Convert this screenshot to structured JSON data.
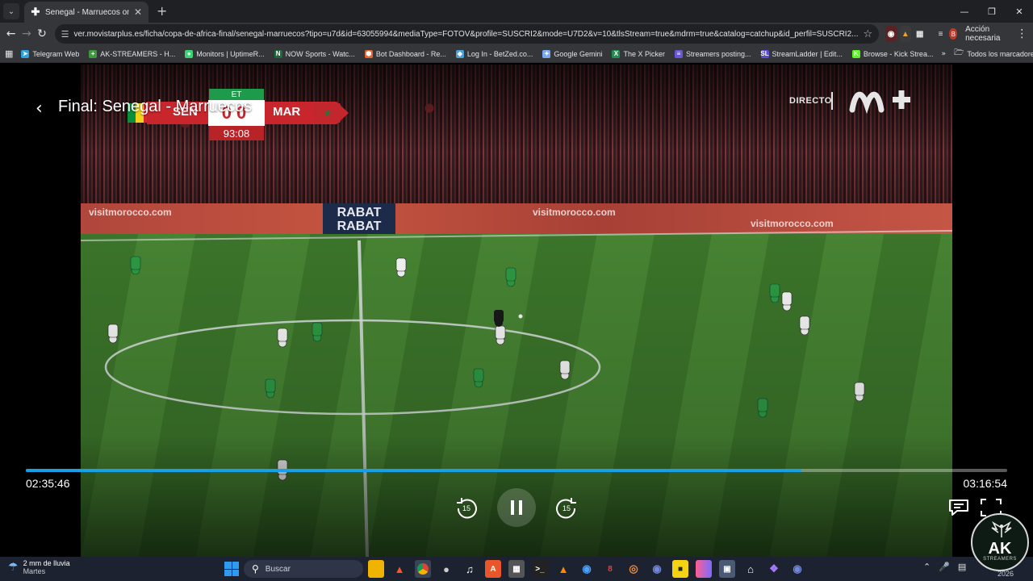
{
  "browser": {
    "tab_title": "Senegal - Marruecos online - M",
    "url": "ver.movistarplus.es/ficha/copa-de-africa-final/senegal-marruecos?tipo=u7d&id=63055994&mediaType=FOTOV&profile=SUSCRI2&mode=U7D2&v=10&tlsStream=true&mdrm=true&catalog=catchup&id_perfil=SUSCRI2...",
    "accion": "Acción necesaria",
    "profile_initial": "B",
    "bookmarks": [
      {
        "label": "Telegram Web",
        "color": "#2aa3df",
        "glyph": "➤"
      },
      {
        "label": "AK-STREAMERS - H...",
        "color": "#3c9a3c",
        "glyph": "+"
      },
      {
        "label": "Monitors | UptimeR...",
        "color": "#3bd671",
        "glyph": "●"
      },
      {
        "label": "NOW Sports - Watc...",
        "color": "#1b6a3a",
        "glyph": "N"
      },
      {
        "label": "Bot Dashboard - Re...",
        "color": "#e8662a",
        "glyph": "⬢"
      },
      {
        "label": "Log In - BetZed.co...",
        "color": "#4aa0d8",
        "glyph": "◈"
      },
      {
        "label": "Google Gemini",
        "color": "#7aa7f2",
        "glyph": "✦"
      },
      {
        "label": "The X Picker",
        "color": "#1f8f4f",
        "glyph": "X"
      },
      {
        "label": "Streamers posting...",
        "color": "#6b57d6",
        "glyph": "≡"
      },
      {
        "label": "StreamLadder | Edit...",
        "color": "#5b4bd8",
        "glyph": "SL"
      },
      {
        "label": "Browse - Kick Strea...",
        "color": "#53fc18",
        "glyph": "K"
      }
    ],
    "all_bookmarks": "Todos los marcadores"
  },
  "player": {
    "title": "Final: Senegal - Marruecos",
    "live_label": "DIRECTO",
    "current_time": "02:35:46",
    "duration": "03:16:54",
    "progress_fraction": 0.79,
    "skip_back_label": "15",
    "skip_forward_label": "15",
    "accent_color": "#18a0e6"
  },
  "scoreboard": {
    "period": "ET",
    "home": "SEN",
    "away": "MAR",
    "home_score": "0",
    "away_score": "0",
    "clock": "93:08"
  },
  "stadium": {
    "board_text_1": "RABAT",
    "board_text_2": "RABAT",
    "ads": [
      "visitmorocco.com",
      "visitmorocco.com",
      "visitmorocco.com"
    ]
  },
  "taskbar": {
    "weather_line1": "2 mm de lluvia",
    "weather_line2": "Martes",
    "search_label": "Buscar",
    "year": "2026"
  },
  "watermark": {
    "text": "AK",
    "subtext": "STREAMERS"
  }
}
